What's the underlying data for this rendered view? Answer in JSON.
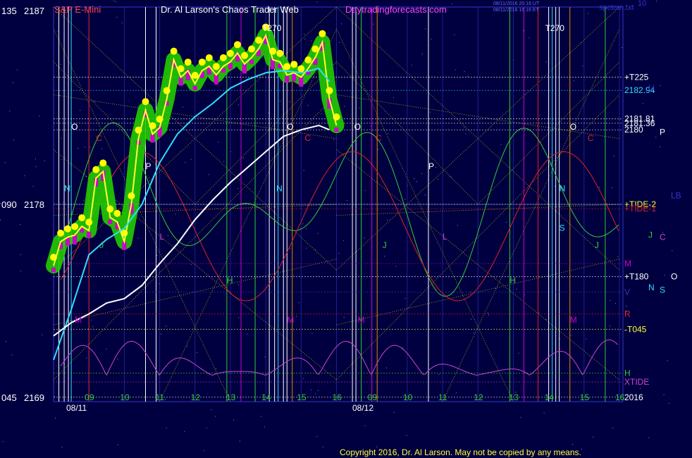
{
  "header": {
    "symbol": "S&P E-Mini",
    "author": "Dr. Al Larson's Chaos Trader Web",
    "site": "Daytradingforecasts.com",
    "timestamp1": "08/11/2016 20:16 UT",
    "timestamp2": "08/11/2016 16:16 ET",
    "file_name": "spctcm.txt",
    "top_right": "10"
  },
  "footer": {
    "copyright": "Copyright 2016, Dr. Al Larson. May not be copied by any means."
  },
  "colors": {
    "background": "#000040",
    "price_line": "#ffff33",
    "glow": "#22cc00",
    "dots": "#ffff00",
    "bars": "#cc00cc",
    "ma_fast": "#33ddff",
    "ma_slow": "#ffffff",
    "green_cycle": "#33cc33",
    "red_cycle": "#dd2222",
    "xtide": "#cc44cc",
    "grid": "#3333cc",
    "yellow_lines": "#dddd00"
  },
  "chart_data": {
    "type": "line",
    "title": "S&P E-Mini",
    "y_axis": {
      "range": [
        2169,
        2187
      ],
      "ticks": [
        {
          "left": "135",
          "value": 2187
        },
        {
          "left": "090",
          "value": 2178
        },
        {
          "left": "045",
          "value": 2169
        }
      ]
    },
    "x_axis": {
      "dates": [
        {
          "label": "08/11",
          "hour": 8.25
        },
        {
          "label": "08/12",
          "hour": 16.25
        }
      ],
      "hour_ticks": [
        {
          "label": "09",
          "hour": 9
        },
        {
          "label": "10",
          "hour": 10
        },
        {
          "label": "11",
          "hour": 11
        },
        {
          "label": "12",
          "hour": 12
        },
        {
          "label": "13",
          "hour": 13
        },
        {
          "label": "14",
          "hour": 14
        },
        {
          "label": "15",
          "hour": 15
        },
        {
          "label": "16",
          "hour": 16
        },
        {
          "label": "09",
          "hour": 17
        },
        {
          "label": "10",
          "hour": 18
        },
        {
          "label": "11",
          "hour": 19
        },
        {
          "label": "12",
          "hour": 20
        },
        {
          "label": "13",
          "hour": 21
        },
        {
          "label": "14",
          "hour": 22
        },
        {
          "label": "15",
          "hour": 23
        },
        {
          "label": "16",
          "hour": 24
        }
      ],
      "range": [
        8,
        24.1
      ]
    },
    "price": {
      "name": "S&P E-Mini",
      "x": [
        8.0,
        8.2,
        8.4,
        8.6,
        8.8,
        9.0,
        9.2,
        9.4,
        9.6,
        9.8,
        10.0,
        10.2,
        10.4,
        10.6,
        10.8,
        11.0,
        11.2,
        11.4,
        11.6,
        11.8,
        12.0,
        12.2,
        12.4,
        12.6,
        12.8,
        13.0,
        13.2,
        13.4,
        13.6,
        13.8,
        14.0,
        14.2,
        14.4,
        14.6,
        14.8,
        15.0,
        15.2,
        15.4,
        15.6,
        15.8,
        16.0
      ],
      "y": [
        2175.2,
        2176.3,
        2176.5,
        2176.6,
        2177.0,
        2176.8,
        2179.2,
        2179.5,
        2177.4,
        2177.2,
        2176.3,
        2178.0,
        2181.0,
        2182.3,
        2181.2,
        2181.5,
        2182.8,
        2184.6,
        2183.8,
        2184.1,
        2183.5,
        2184.1,
        2184.3,
        2183.9,
        2184.3,
        2184.5,
        2184.9,
        2184.4,
        2184.7,
        2185.1,
        2185.7,
        2184.6,
        2184.5,
        2183.9,
        2184.0,
        2183.8,
        2184.2,
        2184.7,
        2185.4,
        2182.8,
        2181.6
      ]
    },
    "moving_average_fast": {
      "x": [
        8.0,
        8.5,
        9.0,
        9.5,
        10.0,
        10.5,
        11.0,
        11.5,
        12.0,
        12.5,
        13.0,
        13.5,
        14.0,
        14.5,
        15.0,
        15.5,
        15.8
      ],
      "y": [
        2170.9,
        2173.2,
        2175.7,
        2176.4,
        2176.9,
        2178.0,
        2179.9,
        2181.2,
        2182.0,
        2182.6,
        2183.3,
        2183.7,
        2184.0,
        2184.1,
        2184.0,
        2184.2,
        2183.6
      ]
    },
    "moving_average_slow": {
      "x": [
        8.0,
        8.5,
        9.0,
        9.5,
        10.0,
        10.5,
        11.0,
        11.5,
        12.0,
        12.5,
        13.0,
        13.5,
        14.0,
        14.5,
        15.0,
        15.5,
        15.8
      ],
      "y": [
        2172.0,
        2172.6,
        2173.0,
        2173.5,
        2173.7,
        2174.3,
        2175.3,
        2176.2,
        2177.3,
        2178.2,
        2179.0,
        2179.7,
        2180.4,
        2181.1,
        2181.4,
        2181.6,
        2181.4
      ]
    },
    "levels": [
      {
        "label": "+T225",
        "value": 2183.8,
        "color": "#ffffff"
      },
      {
        "label": "2182.94",
        "value": 2183.2,
        "color": "#33ddff"
      },
      {
        "label": "2181.81",
        "value": 2181.9,
        "color": "#ffffff"
      },
      {
        "label": "2181.36",
        "value": 2181.7,
        "color": "#ffffff"
      },
      {
        "label": "2180",
        "value": 2181.4,
        "color": "#ffffff"
      },
      {
        "label": "+TIDE-2",
        "value": 2178.0,
        "color": "#ffff33"
      },
      {
        "label": "+TIDE-1",
        "value": 2177.8,
        "color": "#dd2222"
      },
      {
        "label": "M",
        "value": 2175.3,
        "color": "#cc00cc"
      },
      {
        "label": "+T180",
        "value": 2174.7,
        "color": "#ffffff"
      },
      {
        "label": "V",
        "value": 2174.0,
        "color": "#3333cc"
      },
      {
        "label": "R",
        "value": 2173.0,
        "color": "#dd2222"
      },
      {
        "label": "-T045",
        "value": 2172.3,
        "color": "#ffff33"
      },
      {
        "label": "H",
        "value": 2170.3,
        "color": "#33cc33"
      },
      {
        "label": "XTIDE",
        "value": 2169.9,
        "color": "#cc44cc"
      },
      {
        "label": "2016",
        "value": 2169.2,
        "color": "#ffffff"
      }
    ],
    "right_markers": [
      {
        "label": "U",
        "value": 2183.3,
        "color": "#3333cc"
      },
      {
        "label": "P",
        "value": 2181.3,
        "color": "#ffffff"
      },
      {
        "label": "LB",
        "value": 2178.4,
        "color": "#3333cc"
      },
      {
        "label": "J",
        "value": 2176.6,
        "color": "#33cc33"
      },
      {
        "label": "C",
        "value": 2176.5,
        "color": "#cc44cc"
      },
      {
        "label": "O",
        "value": 2174.7,
        "color": "#ffffff"
      },
      {
        "label": "N",
        "value": 2174.2,
        "color": "#33ddff"
      },
      {
        "label": "S",
        "value": 2174.1,
        "color": "#33ddff"
      }
    ],
    "annotations": [
      {
        "label": "T270",
        "hour": 13.9,
        "value": 2185.9,
        "color": "#ffffff"
      },
      {
        "label": "T270",
        "hour": 21.9,
        "value": 2185.9,
        "color": "#ffffff"
      },
      {
        "label": "O",
        "hour": 8.5,
        "value": 2181.4,
        "color": "#ffffff"
      },
      {
        "label": "O",
        "hour": 14.6,
        "value": 2181.4,
        "color": "#ffffff"
      },
      {
        "label": "O",
        "hour": 16.5,
        "value": 2181.4,
        "color": "#ffffff"
      },
      {
        "label": "O",
        "hour": 22.6,
        "value": 2181.4,
        "color": "#ffffff"
      },
      {
        "label": "P",
        "hour": 10.6,
        "value": 2179.6,
        "color": "#ffffff"
      },
      {
        "label": "P",
        "hour": 18.6,
        "value": 2179.6,
        "color": "#ffffff"
      },
      {
        "label": "N",
        "hour": 8.3,
        "value": 2178.6,
        "color": "#33ddff"
      },
      {
        "label": "N",
        "hour": 14.3,
        "value": 2178.6,
        "color": "#33ddff"
      },
      {
        "label": "N",
        "hour": 22.3,
        "value": 2178.6,
        "color": "#33ddff"
      },
      {
        "label": "S",
        "hour": 22.3,
        "value": 2176.8,
        "color": "#33ddff"
      },
      {
        "label": "M",
        "hour": 8.6,
        "value": 2172.6,
        "color": "#cc00cc"
      },
      {
        "label": "M",
        "hour": 14.6,
        "value": 2172.6,
        "color": "#cc00cc"
      },
      {
        "label": "M",
        "hour": 16.6,
        "value": 2172.6,
        "color": "#cc00cc"
      },
      {
        "label": "M",
        "hour": 22.6,
        "value": 2172.6,
        "color": "#cc00cc"
      },
      {
        "label": "H",
        "hour": 12.9,
        "value": 2174.4,
        "color": "#33cc33"
      },
      {
        "label": "H",
        "hour": 20.9,
        "value": 2174.4,
        "color": "#33cc33"
      },
      {
        "label": "C",
        "hour": 9.2,
        "value": 2180.9,
        "color": "#dd2222"
      },
      {
        "label": "C",
        "hour": 15.1,
        "value": 2180.9,
        "color": "#dd2222"
      },
      {
        "label": "C",
        "hour": 17.1,
        "value": 2180.9,
        "color": "#dd2222"
      },
      {
        "label": "C",
        "hour": 23.1,
        "value": 2180.9,
        "color": "#dd2222"
      },
      {
        "label": "J",
        "hour": 9.3,
        "value": 2176.0,
        "color": "#33cc33"
      },
      {
        "label": "J",
        "hour": 17.3,
        "value": 2176.0,
        "color": "#33cc33"
      },
      {
        "label": "J",
        "hour": 23.3,
        "value": 2176.0,
        "color": "#33cc33"
      },
      {
        "label": "L",
        "hour": 11.0,
        "value": 2176.4,
        "color": "#cc44cc"
      },
      {
        "label": "L",
        "hour": 19.0,
        "value": 2176.4,
        "color": "#cc44cc"
      }
    ],
    "verticals": [
      {
        "hour": 8.15,
        "color": "#ffffff"
      },
      {
        "hour": 8.3,
        "color": "#ffffff"
      },
      {
        "hour": 8.42,
        "color": "#ffffff"
      },
      {
        "hour": 8.5,
        "color": "#33ddff"
      },
      {
        "hour": 9.0,
        "color": "#dd2222"
      },
      {
        "hour": 10.6,
        "color": "#ffffff"
      },
      {
        "hour": 10.9,
        "color": "#ffffff"
      },
      {
        "hour": 12.9,
        "color": "#33cc33"
      },
      {
        "hour": 13.3,
        "color": "#cc00cc"
      },
      {
        "hour": 13.7,
        "color": "#33cc33"
      },
      {
        "hour": 14.1,
        "color": "#ffffff"
      },
      {
        "hour": 14.25,
        "color": "#ffffff"
      },
      {
        "hour": 14.35,
        "color": "#33ddff"
      },
      {
        "hour": 14.5,
        "color": "#ffffff"
      },
      {
        "hour": 14.6,
        "color": "#ffffff"
      },
      {
        "hour": 14.75,
        "color": "#dd8800"
      },
      {
        "hour": 16.45,
        "color": "#ffffff"
      },
      {
        "hour": 16.55,
        "color": "#ffffff"
      },
      {
        "hour": 16.7,
        "color": "#33cc33"
      },
      {
        "hour": 17.0,
        "color": "#cc00cc"
      },
      {
        "hour": 17.15,
        "color": "#dd8800"
      },
      {
        "hour": 18.6,
        "color": "#ffffff"
      },
      {
        "hour": 20.9,
        "color": "#33cc33"
      },
      {
        "hour": 21.3,
        "color": "#cc00cc"
      },
      {
        "hour": 21.7,
        "color": "#dd2222"
      },
      {
        "hour": 22.0,
        "color": "#ffffff"
      },
      {
        "hour": 22.1,
        "color": "#33ddff"
      },
      {
        "hour": 22.2,
        "color": "#ffffff"
      },
      {
        "hour": 22.3,
        "color": "#ffffff"
      },
      {
        "hour": 22.6,
        "color": "#dd8800"
      },
      {
        "hour": 23.6,
        "color": "#33cc33"
      }
    ],
    "grid": true
  }
}
